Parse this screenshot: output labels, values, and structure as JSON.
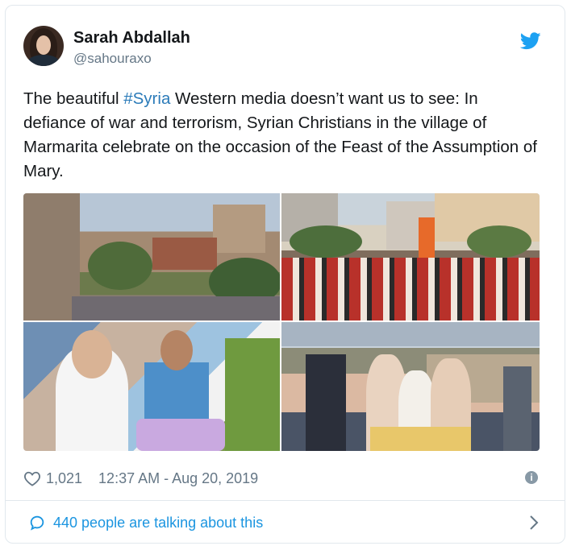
{
  "author": {
    "display_name": "Sarah Abdallah",
    "handle": "@sahouraxo"
  },
  "tweet": {
    "text_before": "The beautiful ",
    "hashtag": "#Syria",
    "text_after": " Western media doesn’t want us to see: In defiance of war and terrorism, Syrian Christians in the village of Marmarita celebrate on the occasion of the Feast of the Assumption of Mary."
  },
  "meta": {
    "likes": "1,021",
    "timestamp": "12:37 AM - Aug 20, 2019"
  },
  "conversation": {
    "label": "440 people are talking about this"
  },
  "icons": {
    "brand": "twitter-bird-icon",
    "like": "heart-icon",
    "info": "info-icon",
    "reply": "speech-bubble-icon",
    "more": "chevron-right-icon"
  },
  "colors": {
    "twitter_blue": "#1da1f2",
    "link": "#1b95e0",
    "secondary_text": "#657786"
  }
}
